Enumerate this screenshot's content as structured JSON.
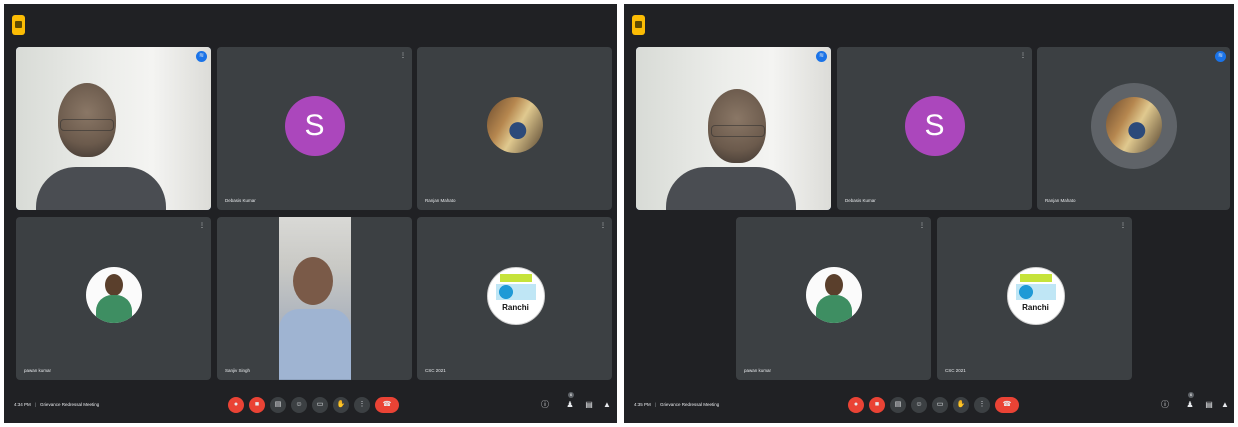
{
  "left_panel": {
    "tiles": [
      {
        "name": "",
        "icon": "active-speaker-icon"
      },
      {
        "name": "Debasis Kumar",
        "avatar_letter": "S",
        "icon": "more-icon"
      },
      {
        "name": "Ranjan Mahato",
        "icon": ""
      },
      {
        "name": "pawan kumar",
        "icon": "more-icon"
      },
      {
        "name": "Sanjiv Singh",
        "icon": ""
      },
      {
        "name": "CSC 2021",
        "logo_text": "Ranchi",
        "icon": "more-icon"
      }
    ]
  },
  "right_panel": {
    "tiles": [
      {
        "name": "",
        "icon": "active-speaker-icon"
      },
      {
        "name": "Debasis Kumar",
        "avatar_letter": "S",
        "icon": "more-icon"
      },
      {
        "name": "Ranjan Mahato",
        "icon": "active-speaker-icon"
      },
      {
        "name": "pawan kumar",
        "icon": "more-icon"
      },
      {
        "name": "CSC 2021",
        "logo_text": "Ranchi",
        "icon": "more-icon"
      }
    ]
  },
  "meeting": {
    "time_left": "4:34 PM",
    "time_right": "4:35 PM",
    "title": "Grievance Redressal Meeting",
    "participants_badge": "6"
  },
  "controls": {
    "mic": "mic-off-icon",
    "camera": "camera-off-icon",
    "captions": "cc",
    "emoji": "☺",
    "present": "▭",
    "hand": "✋",
    "more": "⋮",
    "end": "call-end-icon"
  },
  "colors": {
    "background": "#202124",
    "tile": "#3c4043",
    "end_call": "#ea4335",
    "avatar": "#ab47bc",
    "accent": "#8ab4f8"
  }
}
